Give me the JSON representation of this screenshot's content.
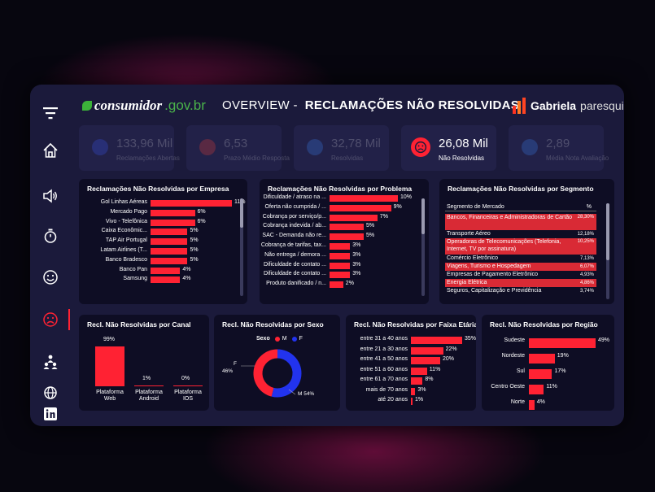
{
  "header": {
    "logo_prefix": "consumidor",
    "logo_suffix": ".gov.br",
    "title_prefix": "OVERVIEW -",
    "title_main": "RECLAMAÇÕES NÃO RESOLVIDAS",
    "brand_name": "Gabriela",
    "brand_surname": "paresqui"
  },
  "sidebar": {
    "items": [
      {
        "name": "filter",
        "icon": "filter-icon"
      },
      {
        "name": "home",
        "icon": "home-icon"
      },
      {
        "name": "complaints",
        "icon": "speaker-icon"
      },
      {
        "name": "timer",
        "icon": "stopwatch-icon"
      },
      {
        "name": "resolved",
        "icon": "smile-icon"
      },
      {
        "name": "unresolved",
        "icon": "sad-face-icon",
        "active": true
      },
      {
        "name": "age",
        "icon": "people-hierarchy-icon"
      },
      {
        "name": "web",
        "icon": "globe-icon"
      },
      {
        "name": "linkedin",
        "icon": "linkedin-icon"
      }
    ]
  },
  "kpis": [
    {
      "value": "133,96 Mil",
      "label": "Reclamações Abertas",
      "active": false
    },
    {
      "value": "6,53",
      "label": "Prazo Médio Resposta",
      "active": false
    },
    {
      "value": "32,78 Mil",
      "label": "Resolvidas",
      "active": false
    },
    {
      "value": "26,08 Mil",
      "label": "Não Resolvidas",
      "active": true
    },
    {
      "value": "2,89",
      "label": "Média Nota Avaliação",
      "active": false
    }
  ],
  "panels": {
    "empresa": {
      "title": "Reclamações Não Resolvidas por Empresa",
      "rows": [
        {
          "label": "Gol Linhas Aéreas",
          "text": "11%",
          "value": 11
        },
        {
          "label": "Mercado Pago",
          "text": "6%",
          "value": 6
        },
        {
          "label": "Vivo - Telefônica",
          "text": "6%",
          "value": 6
        },
        {
          "label": "Caixa Econômic...",
          "text": "5%",
          "value": 5
        },
        {
          "label": "TAP Air Portugal",
          "text": "5%",
          "value": 5
        },
        {
          "label": "Latam Airlines (T...",
          "text": "5%",
          "value": 5
        },
        {
          "label": "Banco Bradesco",
          "text": "5%",
          "value": 5
        },
        {
          "label": "Banco Pan",
          "text": "4%",
          "value": 4
        },
        {
          "label": "Samsung",
          "text": "4%",
          "value": 4
        }
      ]
    },
    "problema": {
      "title": "Reclamações Não Resolvidas por Problema",
      "rows": [
        {
          "label": "Dificuldade / atraso na ...",
          "text": "10%",
          "value": 10
        },
        {
          "label": "Oferta não cumprida / ...",
          "text": "9%",
          "value": 9
        },
        {
          "label": "Cobrança por serviço/p...",
          "text": "7%",
          "value": 7
        },
        {
          "label": "Cobrança indevida / ab...",
          "text": "5%",
          "value": 5
        },
        {
          "label": "SAC - Demanda não re...",
          "text": "5%",
          "value": 5
        },
        {
          "label": "Cobrança de tarifas, tax...",
          "text": "3%",
          "value": 3
        },
        {
          "label": "Não entrega / demora ...",
          "text": "3%",
          "value": 3
        },
        {
          "label": "Dificuldade de contato ...",
          "text": "3%",
          "value": 3
        },
        {
          "label": "Dificuldade de contato ...",
          "text": "3%",
          "value": 3
        },
        {
          "label": "Produto danificado / n...",
          "text": "2%",
          "value": 2
        }
      ]
    },
    "segmento": {
      "title": "Reclamações Não Resolvidas por Segmento",
      "col_segment": "Segmento de Mercado",
      "col_pct": "%",
      "rows": [
        {
          "label": "Bancos, Financeiras e Administradoras de Cartão",
          "pct": "28,30%",
          "highlight": true,
          "lines": 2
        },
        {
          "label": "Transporte Aéreo",
          "pct": "12,18%",
          "highlight": false,
          "lines": 1
        },
        {
          "label": "Operadoras de Telecomunicações (Telefonia, Internet, TV por assinatura)",
          "pct": "10,25%",
          "highlight": true,
          "lines": 2
        },
        {
          "label": "Comércio Eletrônico",
          "pct": "7,13%",
          "highlight": false,
          "lines": 1
        },
        {
          "label": "Viagens, Turismo e Hospedagem",
          "pct": "6,07%",
          "highlight": true,
          "lines": 1
        },
        {
          "label": "Empresas de Pagamento Eletrônico",
          "pct": "4,93%",
          "highlight": false,
          "lines": 1
        },
        {
          "label": "Energia Elétrica",
          "pct": "4,86%",
          "highlight": true,
          "lines": 1
        },
        {
          "label": "Seguros, Capitalização e Previdência",
          "pct": "3,74%",
          "highlight": false,
          "lines": 1
        }
      ]
    },
    "canal": {
      "title": "Recl. Não Resolvidas por Canal",
      "rows": [
        {
          "label": "Plataforma Web",
          "line1": "Plataforma",
          "line2": "Web",
          "text": "99%",
          "value": 99
        },
        {
          "label": "Plataforma Android",
          "line1": "Plataforma",
          "line2": "Android",
          "text": "1%",
          "value": 1
        },
        {
          "label": "Plataforma IOS",
          "line1": "Plataforma",
          "line2": "IOS",
          "text": "0%",
          "value": 0
        }
      ]
    },
    "sexo": {
      "title": "Recl. Não Resolvidas por Sexo",
      "legend_title": "Sexo",
      "slices": [
        {
          "name": "M",
          "value": 54,
          "label": "M 54%",
          "color": "#2233ee"
        },
        {
          "name": "F",
          "value": 46,
          "label": "F 46%",
          "color": "#ff2233"
        }
      ],
      "label_f_letter": "F",
      "label_f_pct": "46%",
      "label_m": "M 54%"
    },
    "faixa": {
      "title": "Recl. Não Resolvidas por Faixa Etária",
      "rows": [
        {
          "label": "entre 31 a 40 anos",
          "text": "35%",
          "value": 35
        },
        {
          "label": "entre 21 a 30 anos",
          "text": "22%",
          "value": 22
        },
        {
          "label": "entre 41 a 50 anos",
          "text": "20%",
          "value": 20
        },
        {
          "label": "entre 51 a 60 anos",
          "text": "11%",
          "value": 11
        },
        {
          "label": "entre 61 a 70 anos",
          "text": "8%",
          "value": 8
        },
        {
          "label": "mais de 70 anos",
          "text": "3%",
          "value": 3
        },
        {
          "label": "até 20 anos",
          "text": "1%",
          "value": 1
        }
      ]
    },
    "regiao": {
      "title": "Recl. Não Resolvidas por Região",
      "rows": [
        {
          "label": "Sudeste",
          "text": "49%",
          "value": 49
        },
        {
          "label": "Nordeste",
          "text": "19%",
          "value": 19
        },
        {
          "label": "Sul",
          "text": "17%",
          "value": 17
        },
        {
          "label": "Centro Oeste",
          "text": "11%",
          "value": 11
        },
        {
          "label": "Norte",
          "text": "4%",
          "value": 4
        }
      ]
    }
  },
  "colors": {
    "accent": "#ff2233",
    "blue": "#2233ee",
    "panel": "#0e0d24",
    "frame": "#1b1a3b"
  }
}
